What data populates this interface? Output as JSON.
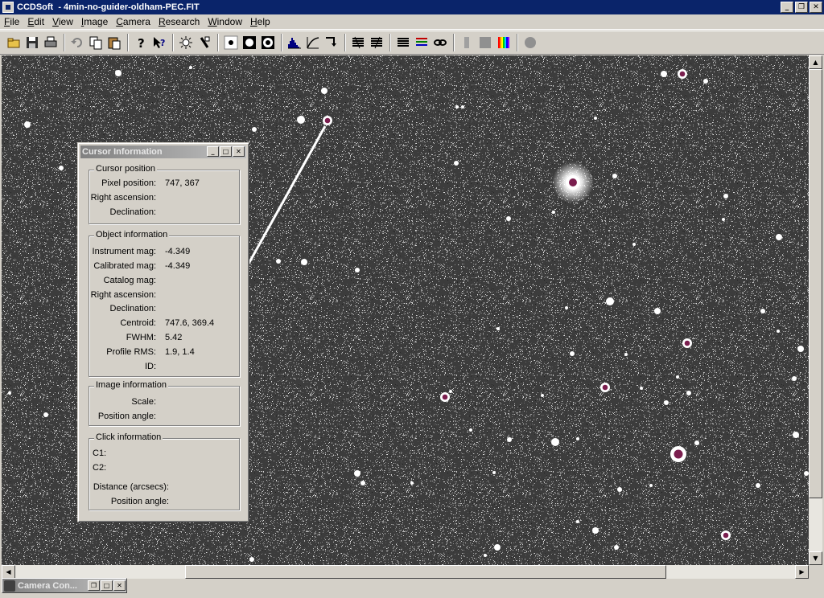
{
  "window": {
    "title": "CCDSoft  - 4min-no-guider-oldham-PEC.FIT",
    "minimize": "_",
    "restore": "❐",
    "close": "✕"
  },
  "menu": [
    {
      "label": "File",
      "ul": "F",
      "rest": "ile"
    },
    {
      "label": "Edit",
      "ul": "E",
      "rest": "dit"
    },
    {
      "label": "View",
      "ul": "V",
      "rest": "iew"
    },
    {
      "label": "Image",
      "ul": "I",
      "rest": "mage"
    },
    {
      "label": "Camera",
      "ul": "C",
      "rest": "amera"
    },
    {
      "label": "Research",
      "ul": "R",
      "rest": "esearch"
    },
    {
      "label": "Window",
      "ul": "W",
      "rest": "indow"
    },
    {
      "label": "Help",
      "ul": "H",
      "rest": "elp"
    }
  ],
  "toolbar_icons": [
    "open-icon",
    "save-icon",
    "print-icon",
    "sep",
    "undo-icon",
    "copy-icon",
    "paste-icon",
    "sep",
    "help-icon",
    "context-help-icon",
    "sep",
    "brightness-icon",
    "contrast-icon",
    "sep",
    "star-small-icon",
    "star-medium-icon",
    "star-large-icon",
    "sep",
    "histogram-icon",
    "curve-icon",
    "transform-icon",
    "sep",
    "stack-1-icon",
    "stack-2-icon",
    "sep",
    "stack-3-icon",
    "stack-color-icon",
    "link-icon",
    "sep",
    "gray-bar-icon",
    "gray-square-icon",
    "rainbow-icon",
    "sep",
    "circle-icon"
  ],
  "cursor_info": {
    "title": "Cursor Information",
    "cursor_position": {
      "heading": "Cursor position",
      "pixel_position_label": "Pixel position:",
      "pixel_position_value": "747, 367",
      "ra_label": "Right ascension:",
      "dec_label": "Declination:"
    },
    "object_information": {
      "heading": "Object information",
      "instrument_mag_label": "Instrument mag:",
      "instrument_mag_value": "-4.349",
      "calibrated_mag_label": "Calibrated mag:",
      "calibrated_mag_value": "-4.349",
      "catalog_mag_label": "Catalog mag:",
      "ra_label": "Right ascension:",
      "dec_label": "Declination:",
      "centroid_label": "Centroid:",
      "centroid_value": "747.6, 369.4",
      "fwhm_label": "FWHM:",
      "fwhm_value": "5.42",
      "profile_rms_label": "Profile RMS:",
      "profile_rms_value": "1.9, 1.4",
      "id_label": "ID:"
    },
    "image_information": {
      "heading": "Image information",
      "scale_label": "Scale:",
      "position_angle_label": "Position angle:"
    },
    "click_information": {
      "heading": "Click information",
      "c1_label": "C1:",
      "c2_label": "C2:",
      "distance_label": "Distance (arcsecs):",
      "position_angle_label": "Position angle:"
    }
  },
  "minimized_window": {
    "title": "Camera Con..."
  }
}
